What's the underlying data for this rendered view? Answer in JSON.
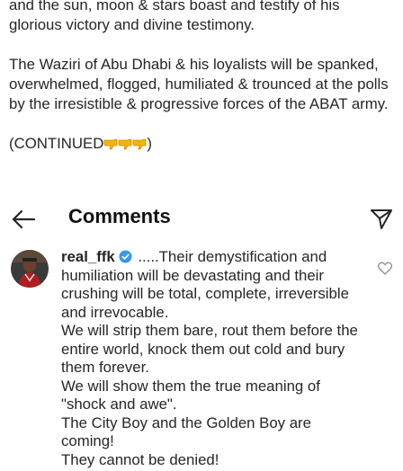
{
  "caption": {
    "paragraph1": "and the sun, moon & stars boast and testify of his glorious victory and divine testimony.",
    "paragraph2": "The Waziri of Abu Dhabi & his loyalists will be spanked, overwhelmed, flogged, humiliated & trounced at the polls by the irresistible & progressive forces of the ABAT army.",
    "continued_prefix": "(CONTINUED",
    "continued_suffix": ")",
    "emoji_icon": "backhand-index-pointing-down"
  },
  "header": {
    "title": "Comments",
    "back_icon": "arrow-left-icon",
    "send_icon": "paper-plane-icon"
  },
  "comment": {
    "username": "real_ffk",
    "verified": true,
    "lines": [
      " .....Their demystification and humiliation will be devastating and their crushing will be total, complete, irreversible and irrevocable.",
      "We will strip them bare, rout them before the entire world, knock them out cold and bury them forever.",
      "We will show them the true meaning of \"shock and awe\".",
      "The City Boy and the Golden Boy are coming!",
      "They cannot be denied!"
    ],
    "like_icon": "heart-outline-icon",
    "accent_color": "#3897f0"
  }
}
